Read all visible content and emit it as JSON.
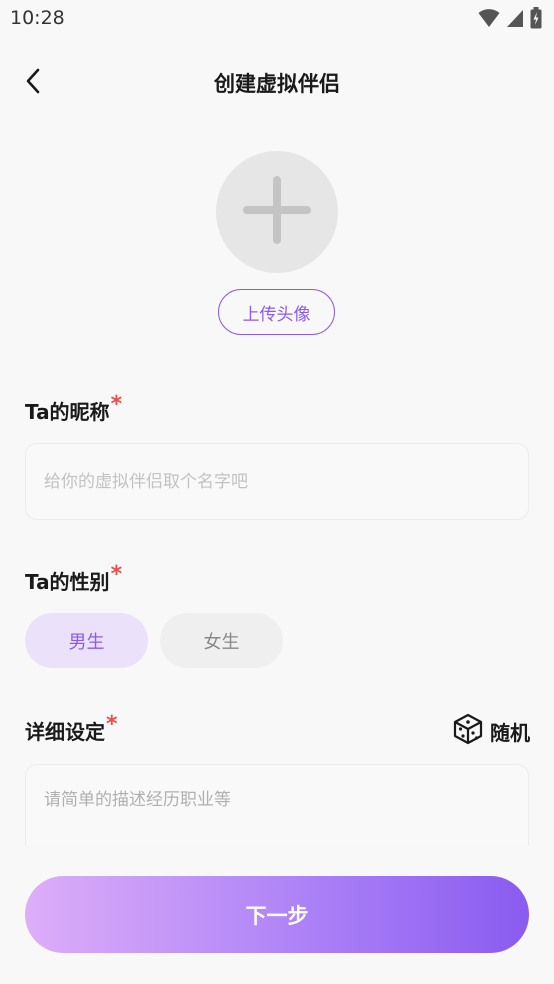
{
  "status_bar": {
    "time": "10:28",
    "icons": [
      "wifi-icon",
      "signal-icon",
      "battery-icon"
    ]
  },
  "header": {
    "back_icon": "chevron-left-icon",
    "title": "创建虚拟伴侣"
  },
  "avatar": {
    "icon": "plus-icon",
    "upload_label": "上传头像"
  },
  "nickname": {
    "label": "Ta的昵称",
    "required_mark": "*",
    "placeholder": "给你的虚拟伴侣取个名字吧",
    "value": ""
  },
  "gender": {
    "label": "Ta的性别",
    "required_mark": "*",
    "options": [
      "男生",
      "女生"
    ],
    "selected": "男生"
  },
  "details": {
    "label": "详细设定",
    "required_mark": "*",
    "random_label": "随机",
    "random_icon": "dice-icon",
    "placeholder": "请简单的描述经历职业等",
    "value": ""
  },
  "next_label": "下一步",
  "colors": {
    "accent": "#8a5bf0",
    "accent_light": "#ebe1fb",
    "required": "#f04a4a",
    "gradient_start": "#ddaef9",
    "gradient_end": "#8a5bf0"
  }
}
